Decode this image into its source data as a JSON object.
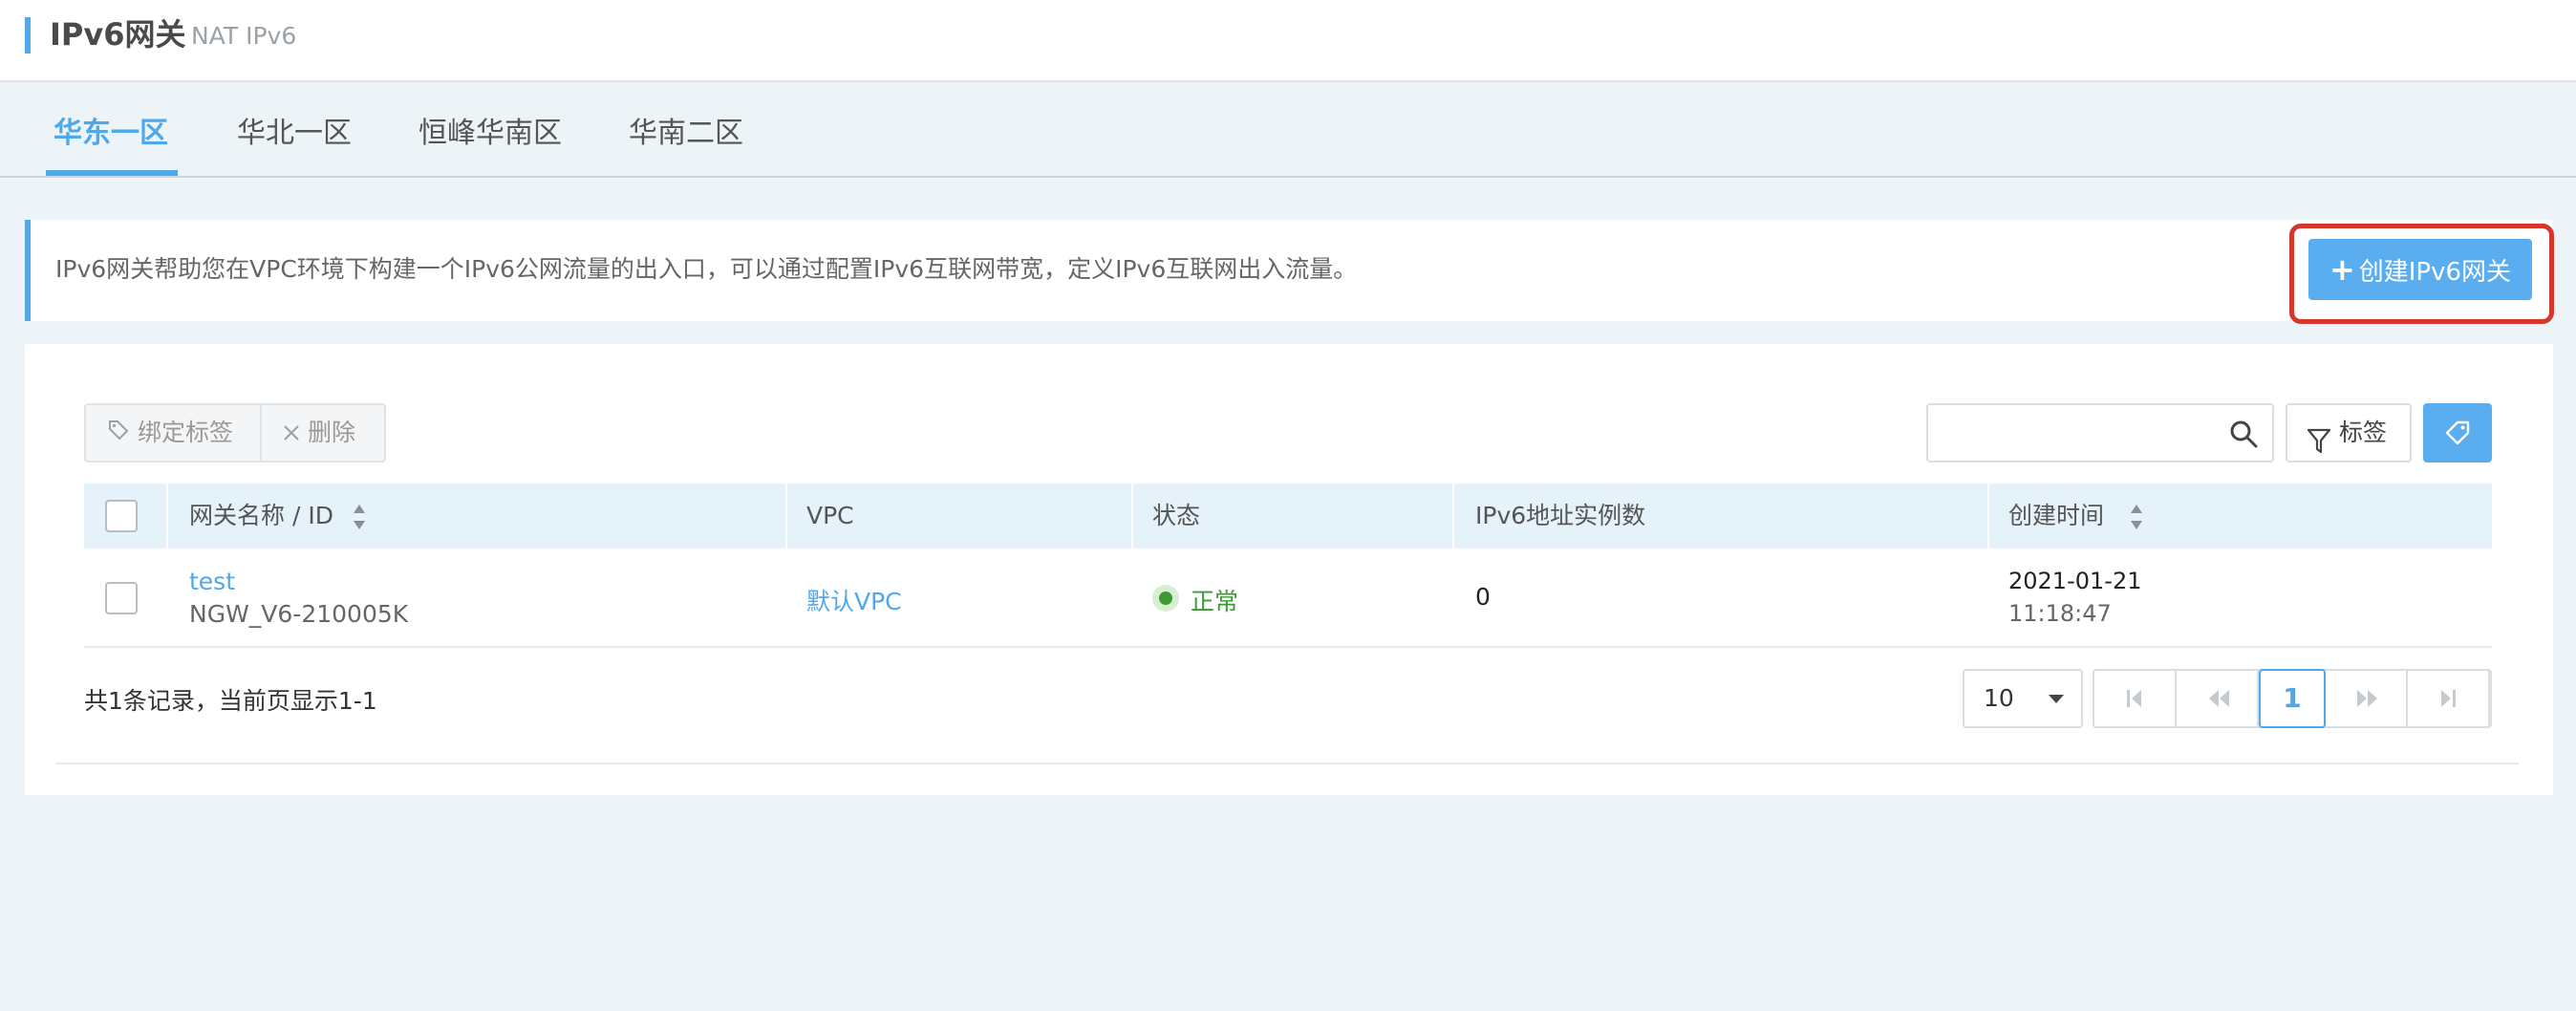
{
  "header": {
    "title": "IPv6网关",
    "subtitle": "NAT IPv6"
  },
  "tabs": [
    {
      "label": "华东一区",
      "active": true
    },
    {
      "label": "华北一区",
      "active": false
    },
    {
      "label": "恒峰华南区",
      "active": false
    },
    {
      "label": "华南二区",
      "active": false
    }
  ],
  "notice": {
    "text": "IPv6网关帮助您在VPC环境下构建一个IPv6公网流量的出入口，可以通过配置IPv6互联网带宽，定义IPv6互联网出入流量。",
    "create_label": "创建IPv6网关"
  },
  "toolbar": {
    "bind_tag_label": "绑定标签",
    "delete_label": "删除",
    "search_placeholder": "",
    "tag_filter_label": "标签"
  },
  "table": {
    "columns": [
      "网关名称 / ID",
      "VPC",
      "状态",
      "IPv6地址实例数",
      "创建时间"
    ],
    "rows": [
      {
        "name": "test",
        "id": "NGW_V6-210005K",
        "vpc": "默认VPC",
        "status": "正常",
        "ipv6_count": "0",
        "created_date": "2021-01-21",
        "created_time": "11:18:47"
      }
    ]
  },
  "pagination": {
    "summary": "共1条记录，当前页显示1-1",
    "page_size": "10",
    "current_page": "1"
  },
  "colors": {
    "accent": "#4fa8ea",
    "button": "#5aaef0",
    "status_ok": "#3b9a32",
    "highlight": "#d7362a"
  }
}
